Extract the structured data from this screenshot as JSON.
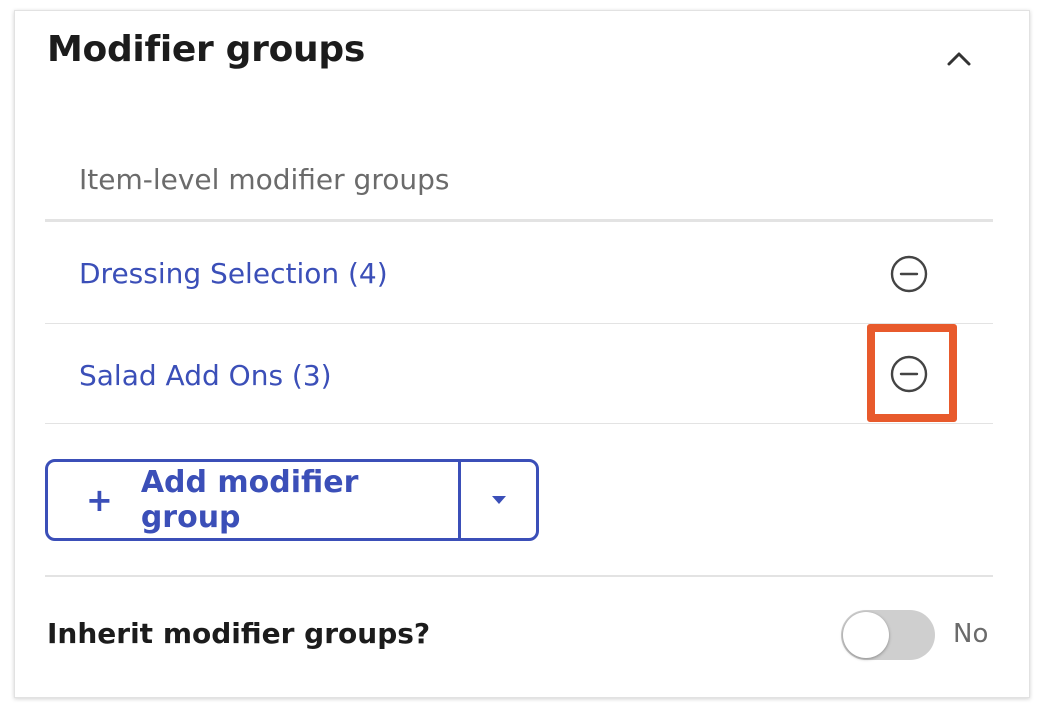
{
  "panel": {
    "title": "Modifier groups",
    "collapse_icon": "chevron-up-icon",
    "section_label": "Item-level modifier groups",
    "groups": [
      {
        "label": "Dressing Selection (4)",
        "remove_icon": "minus-circle-icon"
      },
      {
        "label": "Salad Add Ons (3)",
        "remove_icon": "minus-circle-icon",
        "highlighted": true
      }
    ],
    "add_button": {
      "plus": "+",
      "label": "Add modifier group",
      "dropdown_icon": "caret-down-icon"
    },
    "inherit": {
      "label": "Inherit modifier groups?",
      "toggle_state": false,
      "toggle_text": "No"
    }
  },
  "colors": {
    "accent": "#3b4fb8",
    "highlight": "#e85a2c",
    "muted_text": "#6b6b6b",
    "toggle_off": "#cfcfcf"
  }
}
